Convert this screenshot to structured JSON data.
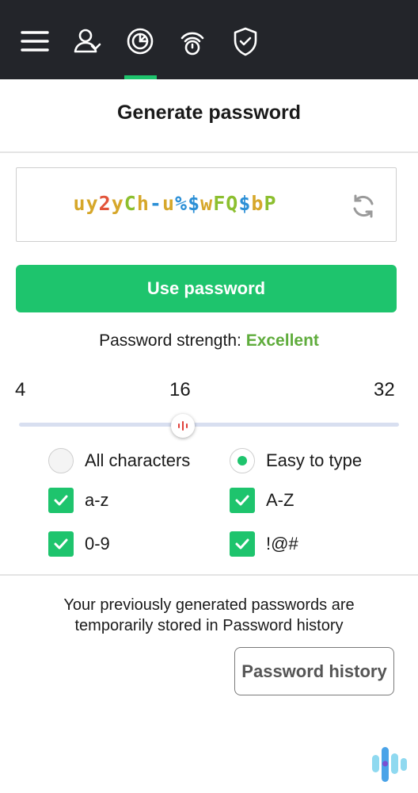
{
  "nav": {
    "items": [
      {
        "icon": "menu-icon",
        "label": "Menu"
      },
      {
        "icon": "user-icon",
        "label": "Account"
      },
      {
        "icon": "vault-icon",
        "label": "Vault"
      },
      {
        "icon": "generator-icon",
        "label": "Generator"
      },
      {
        "icon": "security-icon",
        "label": "Security"
      }
    ],
    "active_index": 2,
    "accent": "#1ec46d",
    "background": "#23252a"
  },
  "page": {
    "title": "Generate password"
  },
  "password": {
    "chars": [
      {
        "c": "u",
        "color": "#d6a72a"
      },
      {
        "c": "y",
        "color": "#d6a72a"
      },
      {
        "c": "2",
        "color": "#e2543a"
      },
      {
        "c": "y",
        "color": "#d6a72a"
      },
      {
        "c": "C",
        "color": "#8cbf2f"
      },
      {
        "c": "h",
        "color": "#d6a72a"
      },
      {
        "c": "-",
        "color": "#2b8fd6"
      },
      {
        "c": "u",
        "color": "#d6a72a"
      },
      {
        "c": "%",
        "color": "#2b8fd6"
      },
      {
        "c": "$",
        "color": "#2b8fd6"
      },
      {
        "c": "w",
        "color": "#d6a72a"
      },
      {
        "c": "F",
        "color": "#8cbf2f"
      },
      {
        "c": "Q",
        "color": "#8cbf2f"
      },
      {
        "c": "$",
        "color": "#2b8fd6"
      },
      {
        "c": "b",
        "color": "#d6a72a"
      },
      {
        "c": "P",
        "color": "#8cbf2f"
      }
    ],
    "refresh_icon": "refresh-icon"
  },
  "use_button": {
    "label": "Use password"
  },
  "strength": {
    "label": "Password strength:",
    "value": "Excellent",
    "color": "#5fac3c"
  },
  "length": {
    "min": "4",
    "current": "16",
    "max": "32",
    "value": 16
  },
  "mode": {
    "all_characters": {
      "label": "All characters",
      "selected": false
    },
    "easy_to_type": {
      "label": "Easy to type",
      "selected": true
    }
  },
  "charsets": {
    "lowercase": {
      "label": "a-z",
      "checked": true
    },
    "uppercase": {
      "label": "A-Z",
      "checked": true
    },
    "digits": {
      "label": "0-9",
      "checked": true
    },
    "symbols": {
      "label": "!@#",
      "checked": true
    }
  },
  "history": {
    "note_line1": "Your previously generated passwords are",
    "note_line2": "temporarily stored in Password history",
    "button_label": "Password history"
  }
}
